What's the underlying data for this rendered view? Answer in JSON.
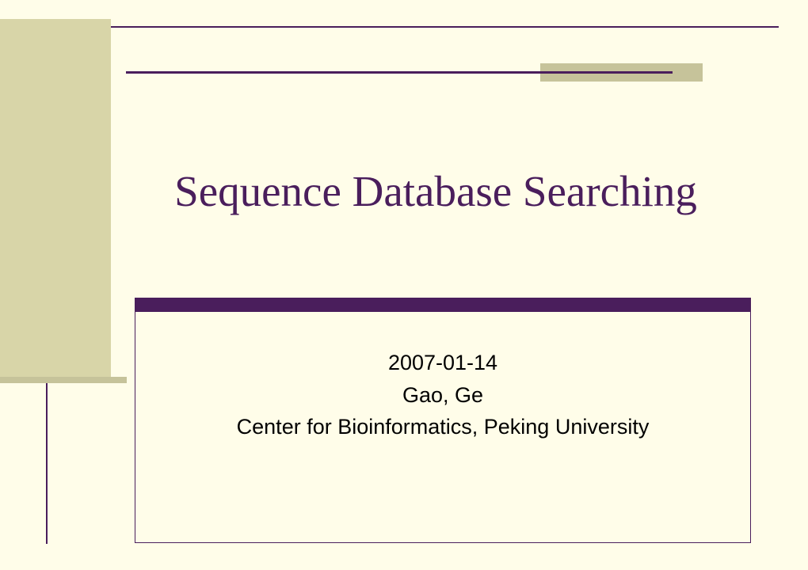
{
  "slide": {
    "title": "Sequence Database Searching",
    "date": "2007-01-14",
    "author": "Gao, Ge",
    "affiliation": "Center for Bioinformatics, Peking University"
  },
  "colors": {
    "accent_purple": "#4a1e5c",
    "bg_cream": "#fffde9",
    "olive": "#d8d5a8",
    "olive_dark": "#c6c39a"
  }
}
